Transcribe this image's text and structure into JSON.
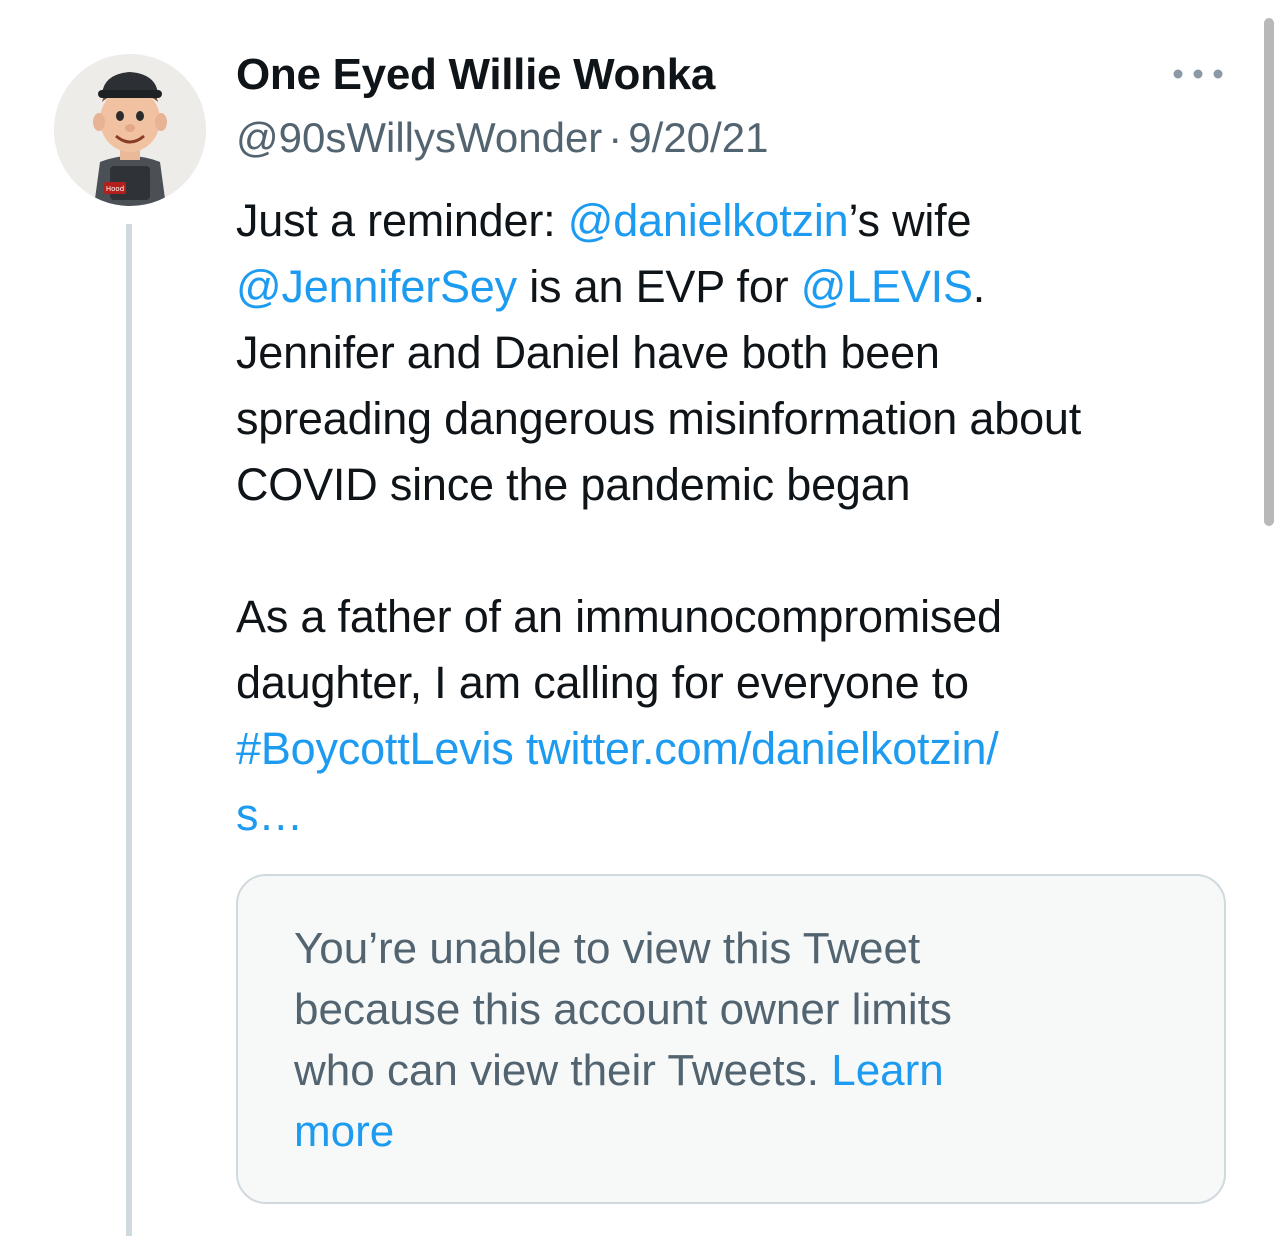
{
  "tweet": {
    "display_name": "One Eyed Willie Wonka",
    "handle": "@90sWillysWonder",
    "separator": "·",
    "date": "9/20/21",
    "more_icon": "more-horizontal-icon",
    "avatar_badge_text": "Hood",
    "text": {
      "l1_a": "Just a reminder: ",
      "l1_mention": "@danielkotzin",
      "l1_b": "’s wife",
      "l2_mention1": "@JenniferSey",
      "l2_b": " is an EVP for ",
      "l2_mention2": "@LEVIS",
      "l2_c": ".",
      "l3": "Jennifer and Daniel have both been",
      "l4": "spreading dangerous misinformation about",
      "l5": "COVID since the pandemic began",
      "l6": "As a father of an immunocompromised",
      "l7": "daughter, I am calling for everyone to",
      "l8_hashtag": "#BoycottLevis",
      "l8_link": "twitter.com/danielkotzin/",
      "l9_link": "s…"
    },
    "quoted": {
      "l1": "You’re unable to view this Tweet",
      "l2": "because this account owner limits",
      "l3_a": "who can view their Tweets. ",
      "l3_learn": "Learn",
      "l4_more": "more"
    }
  },
  "colors": {
    "text": "#0f1419",
    "secondary": "#536471",
    "link": "#1d9bf0",
    "border": "#cfd9de",
    "card_bg": "#f7f9f9"
  }
}
